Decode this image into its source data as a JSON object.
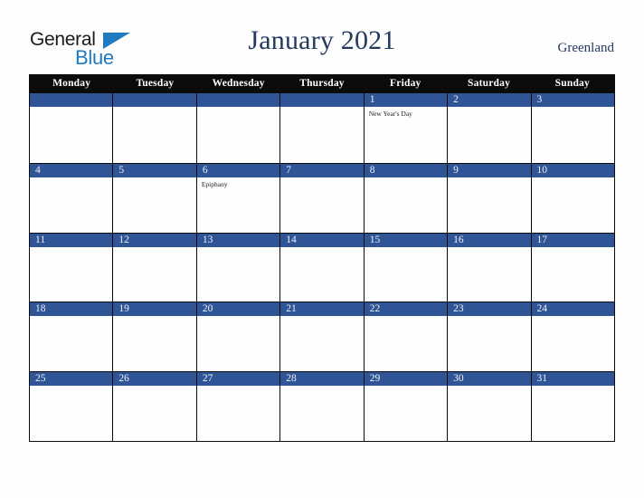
{
  "brand": {
    "name_line1": "General",
    "name_line2": "Blue",
    "color_dark": "#1a1a1a",
    "color_blue": "#1f7ac0"
  },
  "header": {
    "title": "January 2021",
    "region": "Greenland",
    "title_color": "#23395d"
  },
  "calendar": {
    "month": "January",
    "year": "2021",
    "accent_color": "#2f5597",
    "header_bg": "#0b0b0b",
    "day_names": [
      "Monday",
      "Tuesday",
      "Wednesday",
      "Thursday",
      "Friday",
      "Saturday",
      "Sunday"
    ],
    "weeks": [
      [
        {
          "day": "",
          "events": []
        },
        {
          "day": "",
          "events": []
        },
        {
          "day": "",
          "events": []
        },
        {
          "day": "",
          "events": []
        },
        {
          "day": "1",
          "events": [
            "New Year's Day"
          ]
        },
        {
          "day": "2",
          "events": []
        },
        {
          "day": "3",
          "events": []
        }
      ],
      [
        {
          "day": "4",
          "events": []
        },
        {
          "day": "5",
          "events": []
        },
        {
          "day": "6",
          "events": [
            "Epiphany"
          ]
        },
        {
          "day": "7",
          "events": []
        },
        {
          "day": "8",
          "events": []
        },
        {
          "day": "9",
          "events": []
        },
        {
          "day": "10",
          "events": []
        }
      ],
      [
        {
          "day": "11",
          "events": []
        },
        {
          "day": "12",
          "events": []
        },
        {
          "day": "13",
          "events": []
        },
        {
          "day": "14",
          "events": []
        },
        {
          "day": "15",
          "events": []
        },
        {
          "day": "16",
          "events": []
        },
        {
          "day": "17",
          "events": []
        }
      ],
      [
        {
          "day": "18",
          "events": []
        },
        {
          "day": "19",
          "events": []
        },
        {
          "day": "20",
          "events": []
        },
        {
          "day": "21",
          "events": []
        },
        {
          "day": "22",
          "events": []
        },
        {
          "day": "23",
          "events": []
        },
        {
          "day": "24",
          "events": []
        }
      ],
      [
        {
          "day": "25",
          "events": []
        },
        {
          "day": "26",
          "events": []
        },
        {
          "day": "27",
          "events": []
        },
        {
          "day": "28",
          "events": []
        },
        {
          "day": "29",
          "events": []
        },
        {
          "day": "30",
          "events": []
        },
        {
          "day": "31",
          "events": []
        }
      ]
    ]
  }
}
